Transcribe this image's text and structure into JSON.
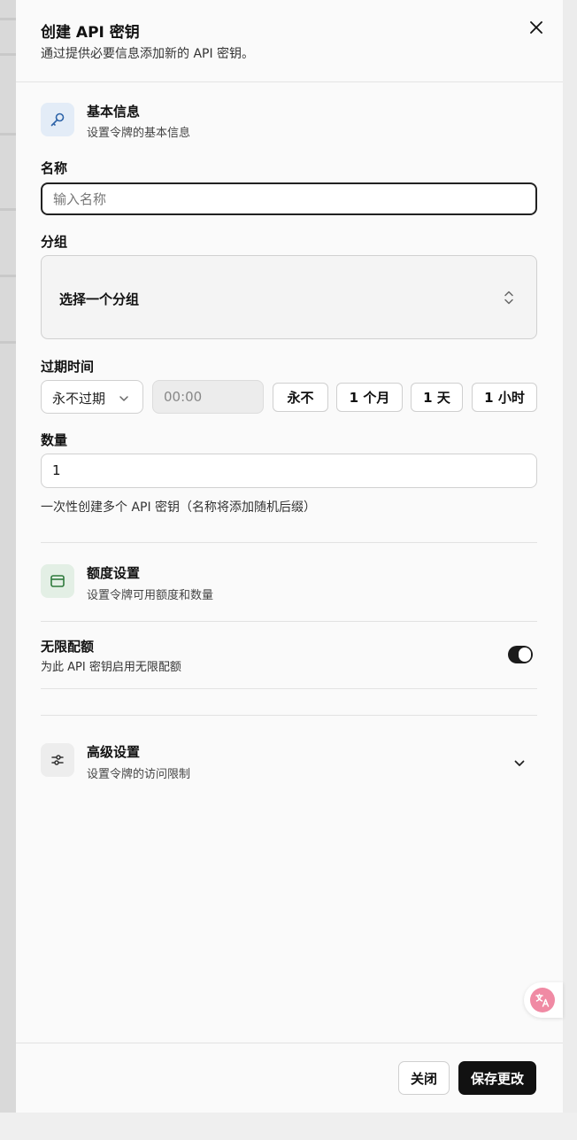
{
  "dialog": {
    "title": "创建 API 密钥",
    "subtitle": "通过提供必要信息添加新的 API 密钥。",
    "close_icon": "close-icon"
  },
  "basic": {
    "icon": "key-icon",
    "title": "基本信息",
    "subtitle": "设置令牌的基本信息"
  },
  "name_field": {
    "label": "名称",
    "placeholder": "输入名称",
    "value": ""
  },
  "group_field": {
    "label": "分组",
    "value": "选择一个分组",
    "icon": "chevron-up-down-icon"
  },
  "expiry": {
    "label": "过期时间",
    "select_value": "永不过期",
    "time_placeholder": "00:00",
    "presets": [
      "永不",
      "1 个月",
      "1 天",
      "1 小时"
    ]
  },
  "quantity": {
    "label": "数量",
    "value": "1",
    "help": "一次性创建多个 API 密钥（名称将添加随机后缀）"
  },
  "quota": {
    "icon": "wallet-icon",
    "title": "额度设置",
    "subtitle": "设置令牌可用额度和数量",
    "unlimited_title": "无限配额",
    "unlimited_desc": "为此 API 密钥启用无限配额",
    "unlimited_on": true
  },
  "advanced": {
    "icon": "sliders-icon",
    "title": "高级设置",
    "subtitle": "设置令牌的访问限制"
  },
  "footer": {
    "close_label": "关闭",
    "save_label": "保存更改"
  },
  "colors": {
    "key_bg": "#e3ecf7",
    "key_fg": "#2d63a8",
    "wallet_bg": "#e3efe5",
    "wallet_fg": "#2f7a3d",
    "primary": "#111111",
    "translate_fab": "#f08aa4"
  }
}
